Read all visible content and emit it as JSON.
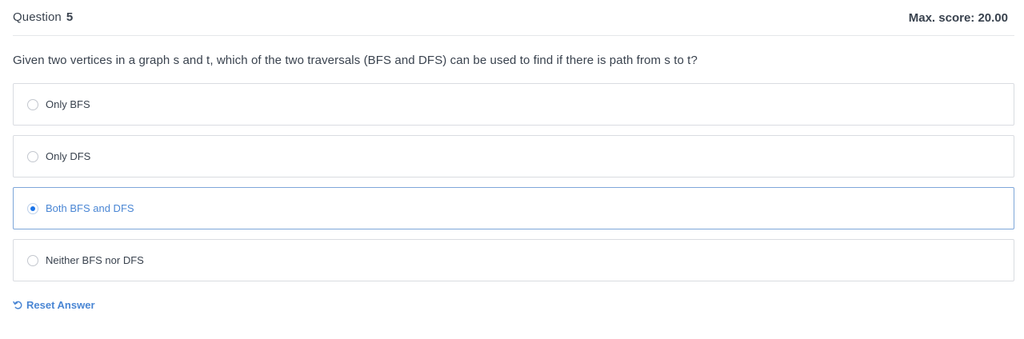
{
  "header": {
    "question_label": "Question",
    "question_number": "5",
    "max_score": "Max. score: 20.00"
  },
  "question": {
    "text": "Given two vertices in a graph s and t, which of the two traversals (BFS and DFS) can be used to find if there is path from s to t?"
  },
  "options": [
    {
      "label": "Only BFS",
      "selected": false
    },
    {
      "label": "Only DFS",
      "selected": false
    },
    {
      "label": "Both BFS and DFS",
      "selected": true
    },
    {
      "label": "Neither BFS nor DFS",
      "selected": false
    }
  ],
  "reset": {
    "label": "Reset Answer",
    "icon": "undo-icon"
  },
  "colors": {
    "accent": "#4a86d4",
    "radio_dot": "#1a73e8",
    "text": "#39424e",
    "border": "#d9dce1"
  }
}
